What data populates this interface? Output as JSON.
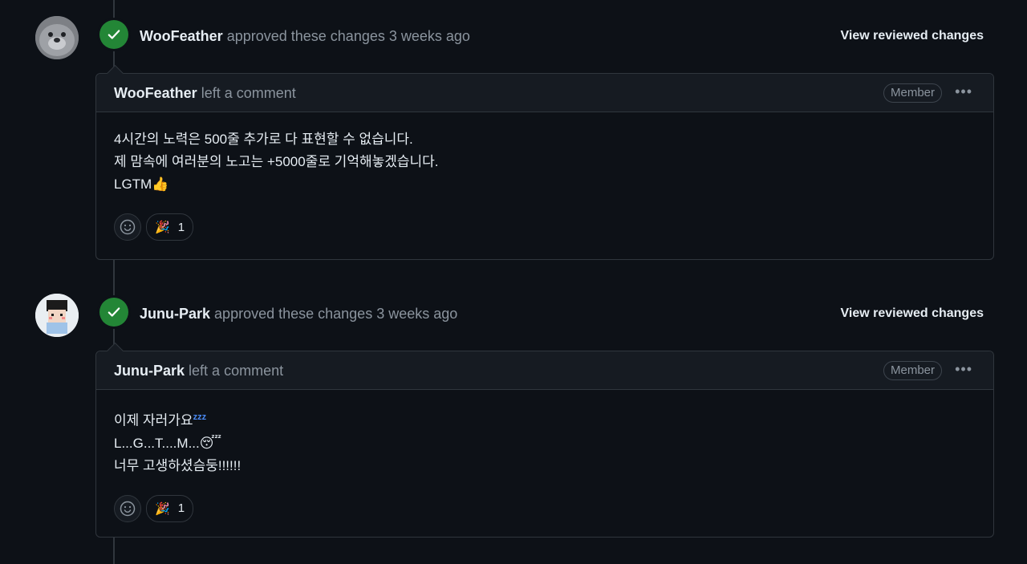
{
  "reviews": [
    {
      "user": "WooFeather",
      "action": "approved these changes",
      "time": "3 weeks ago",
      "view_link": "View reviewed changes",
      "comment": {
        "user": "WooFeather",
        "action": "left a comment",
        "badge": "Member",
        "lines": [
          "4시간의 노력은 500줄 추가로 다 표현할 수 없습니다.",
          "제 맘속에 여러분의 노고는 +5000줄로 기억해놓겠습니다.",
          "LGTM👍"
        ],
        "reaction": {
          "emoji": "🎉",
          "count": "1"
        }
      }
    },
    {
      "user": "Junu-Park",
      "action": "approved these changes",
      "time": "3 weeks ago",
      "view_link": "View reviewed changes",
      "comment": {
        "user": "Junu-Park",
        "action": "left a comment",
        "badge": "Member",
        "lines": [
          "이제 자러가요",
          "L...G...T....M...😴",
          "너무 고생하셨슴둥!!!!!!"
        ],
        "zz": "zzz",
        "reaction": {
          "emoji": "🎉",
          "count": "1"
        }
      }
    }
  ],
  "icons": {
    "check": "check-icon",
    "smiley": "smiley-icon",
    "kebab": "kebab-horizontal-icon"
  },
  "colors": {
    "approved": "#238636",
    "background": "#0d1117",
    "header": "#161b22",
    "muted": "#8b949e"
  }
}
